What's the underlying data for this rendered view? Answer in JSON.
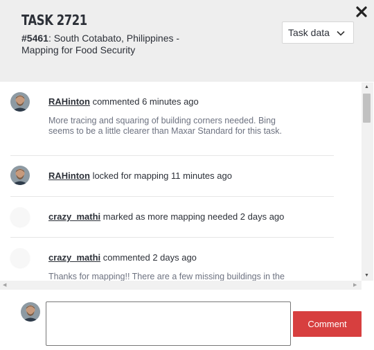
{
  "header": {
    "title": "TASK 2721",
    "project_number": "#5461",
    "project_name": ": South Cotabato, Philippines - Mapping for Food Security",
    "task_data_label": "Task data"
  },
  "feed": [
    {
      "user": "RAHinton",
      "action": "commented 6 minutes ago",
      "text": "More tracing and squaring of building corners needed. Bing seems to be a little clearer than Maxar Standard for this task."
    },
    {
      "user": "RAHinton",
      "action": "locked for mapping 11 minutes ago"
    },
    {
      "user": "crazy_mathi",
      "action": "marked as more mapping needed 2 days ago"
    },
    {
      "user": "crazy_mathi",
      "action": "commented 2 days ago",
      "text": "Thanks for mapping!! There are a few missing buildings in the"
    }
  ],
  "composer": {
    "placeholder": "",
    "button_label": "Comment"
  },
  "colors": {
    "accent": "#d73f3f",
    "header_bg": "#eeeeee"
  }
}
